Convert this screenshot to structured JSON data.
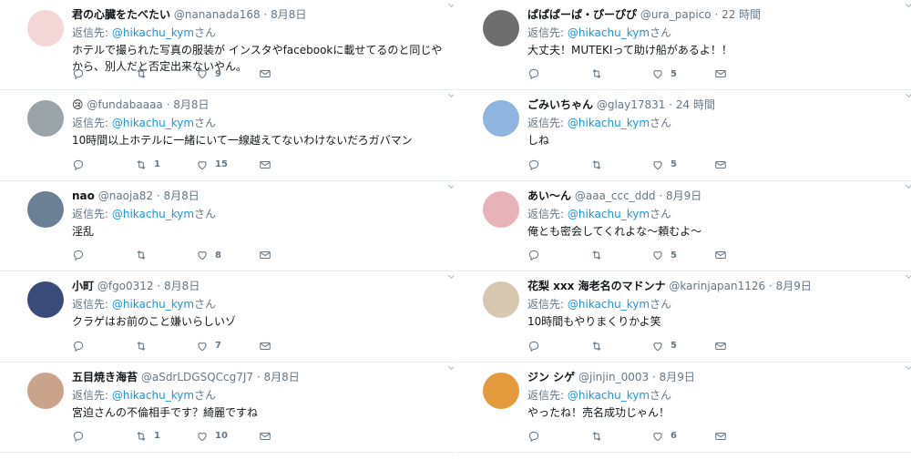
{
  "reply_prefix": "返信先:",
  "left_tweets": [
    {
      "name": "君の心臓をたべたい",
      "handle": "@nananada168",
      "time": "8月8日",
      "reply_to": "@hikachu_kym",
      "reply_suffix": "さん",
      "text": "ホテルで撮られた写真の服装が インスタやfacebookに載せてるのと同じやから、別人だと否定出来ないやん。",
      "retweets": "",
      "likes": "9",
      "avatar_color": "#f3d7d7"
    },
    {
      "name": "😢",
      "handle": "@fundabaaaa",
      "time": "8月8日",
      "reply_to": "@hikachu_kym",
      "reply_suffix": "さん",
      "text": "10時間以上ホテルに一緒にいて一線越えてないわけないだろガバマン",
      "retweets": "1",
      "likes": "15",
      "avatar_color": "#9aa4a8"
    },
    {
      "name": "nao",
      "handle": "@naoja82",
      "time": "8月8日",
      "reply_to": "@hikachu_kym",
      "reply_suffix": "さん",
      "text": "淫乱",
      "retweets": "",
      "likes": "8",
      "avatar_color": "#6b7f95"
    },
    {
      "name": "小町",
      "handle": "@fgo0312",
      "time": "8月8日",
      "reply_to": "@hikachu_kym",
      "reply_suffix": "さん",
      "text": "クラゲはお前のこと嫌いらしいゾ",
      "retweets": "",
      "likes": "7",
      "avatar_color": "#3a4b7a"
    },
    {
      "name": "五目焼き海苔",
      "handle": "@aSdrLDGSQCcg7J7",
      "time": "8月8日",
      "reply_to": "@hikachu_kym",
      "reply_suffix": "さん",
      "text": "宮迫さんの不倫相手です？綺麗ですね",
      "retweets": "1",
      "likes": "10",
      "avatar_color": "#c9a38a"
    }
  ],
  "right_tweets": [
    {
      "name": "ぱぱぱーぱ・ぴーぴぴ",
      "handle": "@ura_papico",
      "time": "22 時間",
      "reply_to": "@hikachu_kym",
      "reply_suffix": "さん",
      "text": "大丈夫！MUTEKIって助け船があるよ！！",
      "retweets": "",
      "likes": "5",
      "avatar_color": "#6e6e6e"
    },
    {
      "name": "ごみいちゃん",
      "handle": "@glay17831",
      "time": "24 時間",
      "reply_to": "@hikachu_kym",
      "reply_suffix": "さん",
      "text": "しね",
      "retweets": "",
      "likes": "5",
      "avatar_color": "#8fb4e0"
    },
    {
      "name": "あい〜ん",
      "handle": "@aaa_ccc_ddd",
      "time": "8月9日",
      "reply_to": "@hikachu_kym",
      "reply_suffix": "さん",
      "text": "俺とも密会してくれよな〜頼むよ〜",
      "retweets": "",
      "likes": "5",
      "avatar_color": "#e8b3b8"
    },
    {
      "name": "花梨 xxx 海老名のマドンナ",
      "handle": "@karinjapan1126",
      "time": "8月9日",
      "reply_to": "@hikachu_kym",
      "reply_suffix": "さん",
      "text": "10時間もやりまくりかよ笑",
      "retweets": "",
      "likes": "5",
      "avatar_color": "#d8c7b0"
    },
    {
      "name": "ジン シゲ",
      "handle": "@jinjin_0003",
      "time": "8月9日",
      "reply_to": "@hikachu_kym",
      "reply_suffix": "さん",
      "text": "やったね！売名成功じゃん！",
      "retweets": "",
      "likes": "6",
      "avatar_color": "#e39a3c"
    }
  ]
}
